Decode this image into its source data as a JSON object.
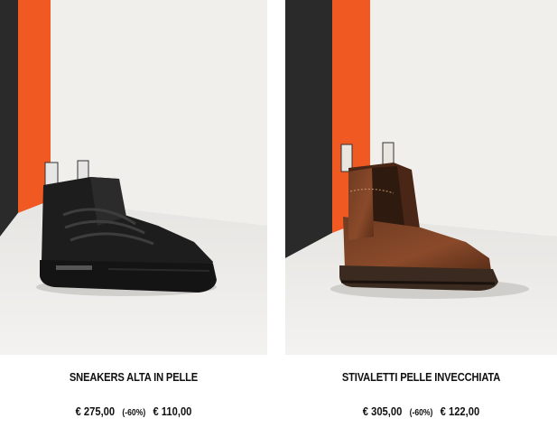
{
  "products": [
    {
      "name": "SNEAKERS ALTA IN PELLE",
      "price_old": "€ 275,00",
      "discount": "(-60%)",
      "price_new": "€ 110,00",
      "image": "black-leather-high-top-sneaker"
    },
    {
      "name": "STIVALETTI PELLE INVECCHIATA",
      "price_old": "€ 305,00",
      "discount": "(-60%)",
      "price_new": "€ 122,00",
      "image": "brown-aged-leather-chelsea-boot"
    }
  ],
  "colors": {
    "backdrop_orange": "#f05a22",
    "backdrop_dark": "#2a2a2a",
    "backdrop_light": "#ecebe8",
    "text": "#111111"
  }
}
